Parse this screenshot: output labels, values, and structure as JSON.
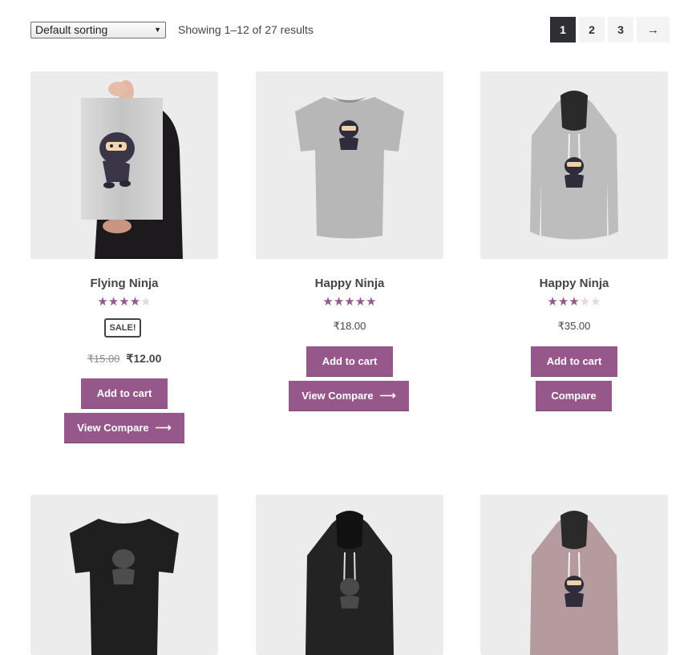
{
  "toolbar": {
    "sort_selected": "Default sorting",
    "result_count": "Showing 1–12 of 27 results"
  },
  "pagination": {
    "pages": [
      "1",
      "2",
      "3"
    ],
    "current": "1",
    "next": "→"
  },
  "products": [
    {
      "title": "Flying Ninja",
      "rating": 4,
      "sale_badge": "SALE!",
      "regular_price": "₹15.00",
      "sale_price": "₹12.00",
      "add_to_cart": "Add to cart",
      "compare": "View Compare",
      "compare_arrow": "⟶"
    },
    {
      "title": "Happy Ninja",
      "rating": 5,
      "price": "₹18.00",
      "add_to_cart": "Add to cart",
      "compare": "View Compare",
      "compare_arrow": "⟶"
    },
    {
      "title": "Happy Ninja",
      "rating": 3,
      "price": "₹35.00",
      "add_to_cart": "Add to cart",
      "compare": "Compare"
    }
  ],
  "colors": {
    "accent": "#96588a",
    "page_current_bg": "#2e2f33",
    "image_bg": "#ececec"
  }
}
